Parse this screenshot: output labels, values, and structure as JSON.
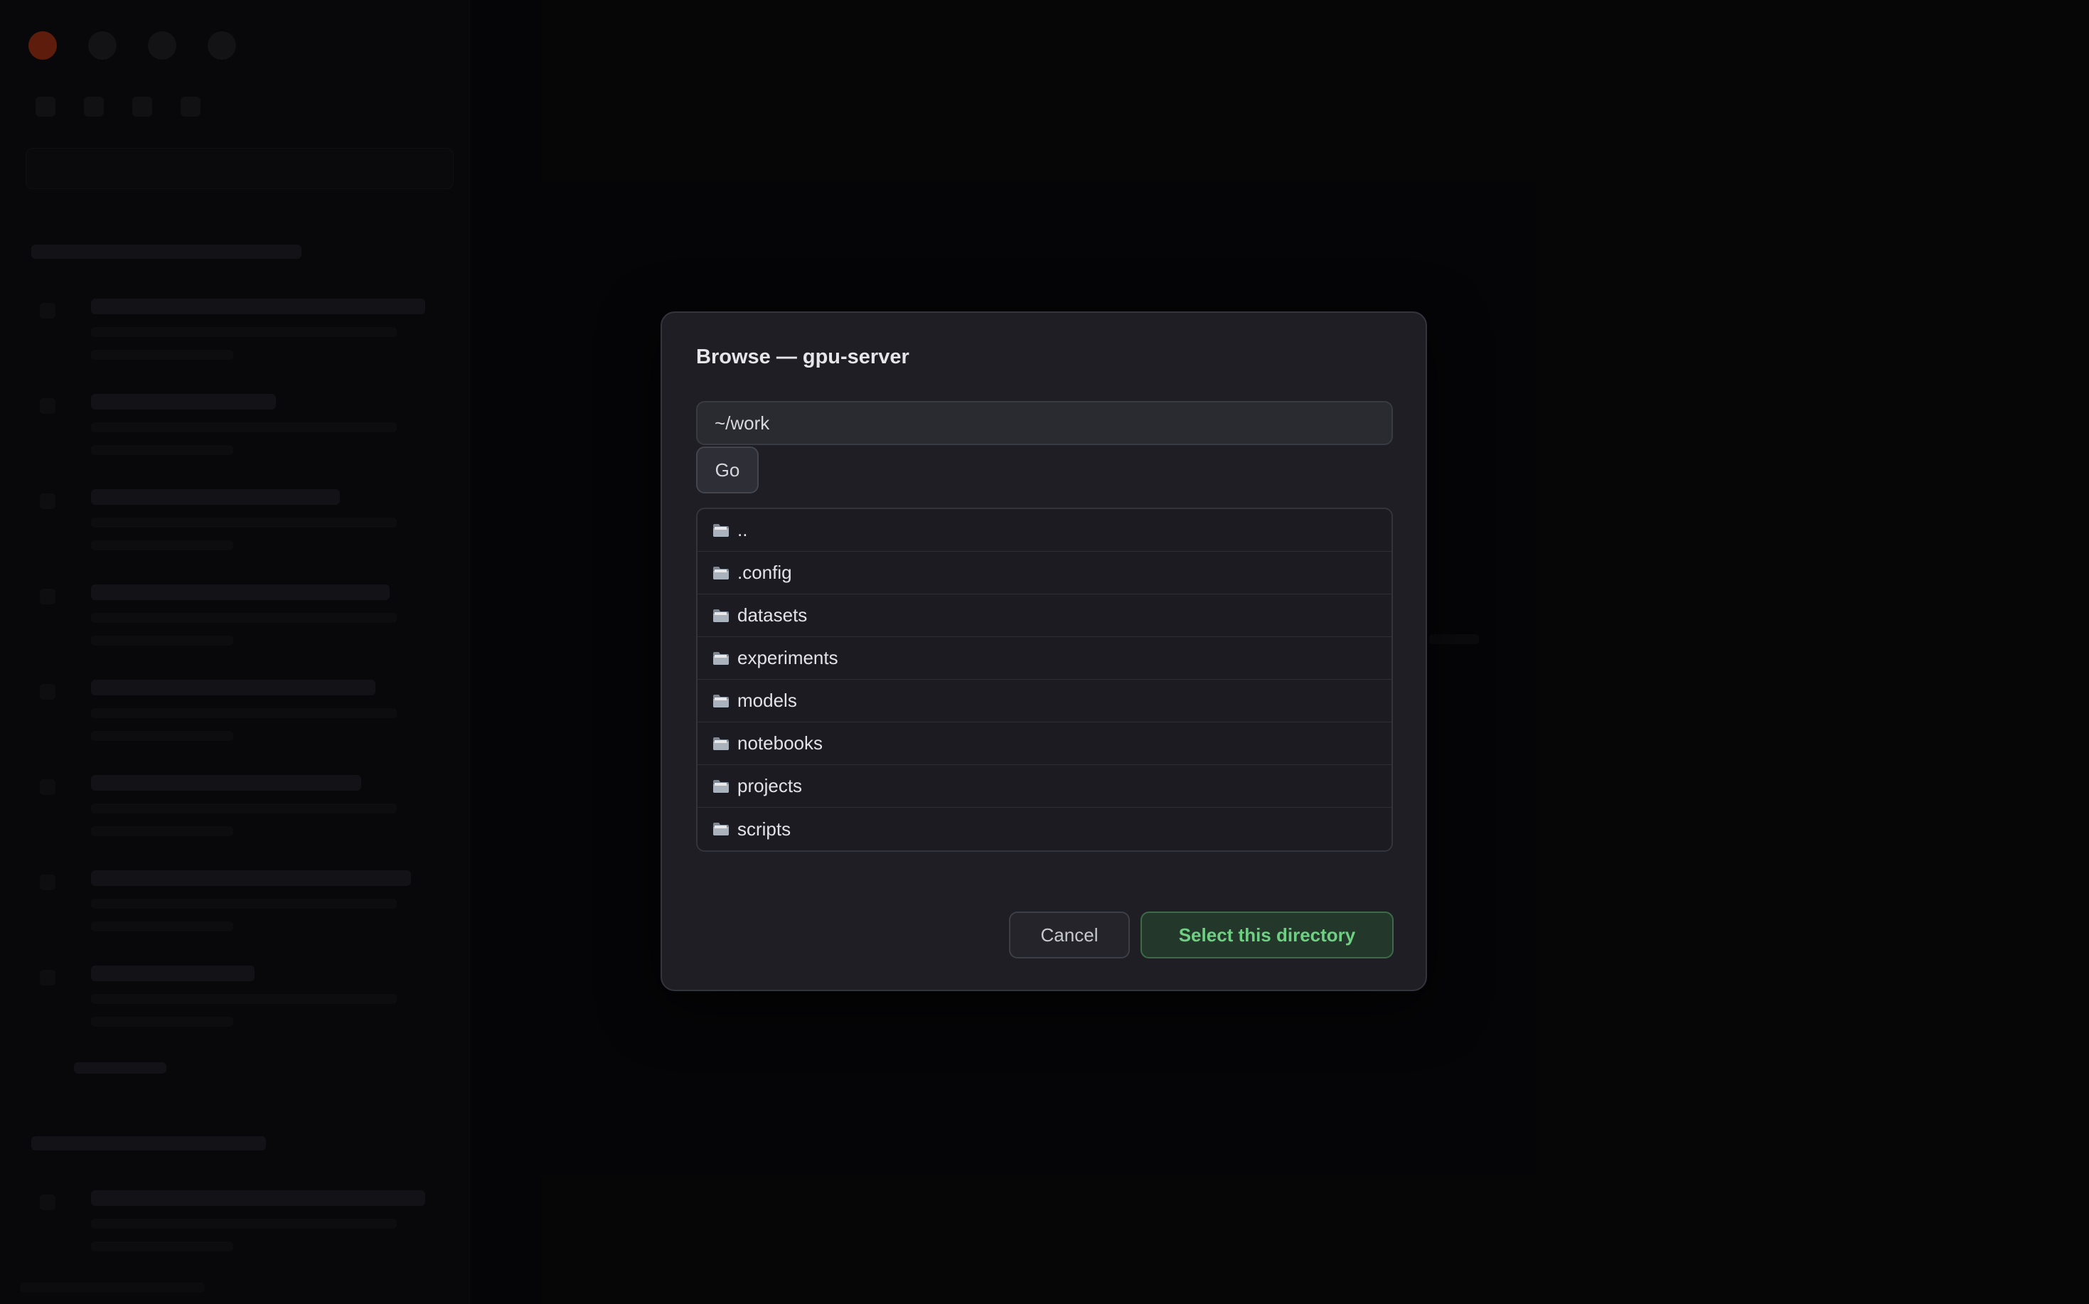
{
  "dialog": {
    "title": "Browse — gpu-server",
    "path_value": "~/work",
    "go_label": "Go",
    "entries": [
      {
        "name": "..",
        "icon": "folder-icon"
      },
      {
        "name": ".config",
        "icon": "folder-icon"
      },
      {
        "name": "datasets",
        "icon": "folder-icon"
      },
      {
        "name": "experiments",
        "icon": "folder-icon"
      },
      {
        "name": "models",
        "icon": "folder-icon"
      },
      {
        "name": "notebooks",
        "icon": "folder-icon"
      },
      {
        "name": "projects",
        "icon": "folder-icon"
      },
      {
        "name": "scripts",
        "icon": "folder-icon"
      }
    ],
    "cancel_label": "Cancel",
    "select_label": "Select this directory"
  },
  "colors": {
    "accent_green": "#6fcf83",
    "dialog_bg": "#1e1e24",
    "backdrop": "#0a0a0c"
  }
}
